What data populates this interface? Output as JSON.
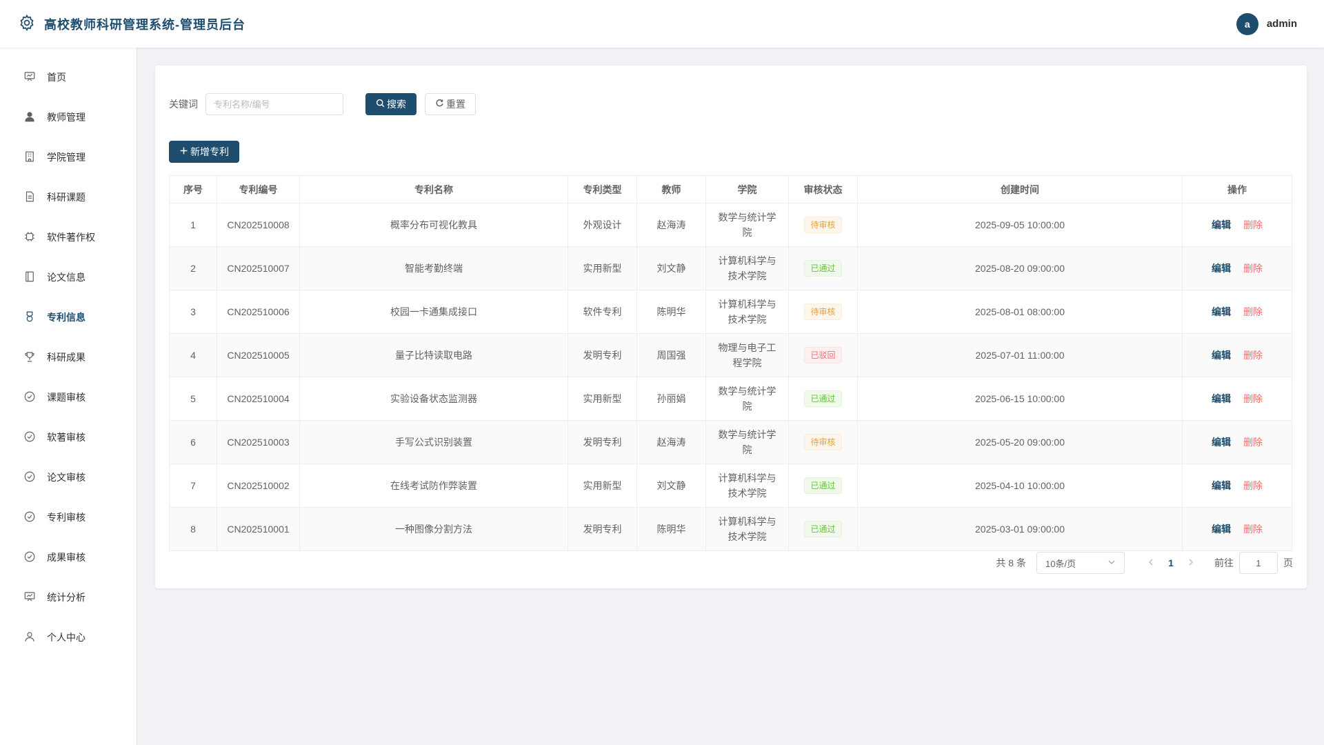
{
  "header": {
    "title": "高校教师科研管理系统-管理员后台",
    "avatar_letter": "a",
    "username": "admin",
    "brand_color": "#1e4d6e"
  },
  "sidebar": {
    "items": [
      {
        "label": "首页",
        "icon": "dashboard-icon"
      },
      {
        "label": "教师管理",
        "icon": "user-solid-icon"
      },
      {
        "label": "学院管理",
        "icon": "building-icon"
      },
      {
        "label": "科研课题",
        "icon": "document-icon"
      },
      {
        "label": "软件著作权",
        "icon": "cpu-icon"
      },
      {
        "label": "论文信息",
        "icon": "notebook-icon"
      },
      {
        "label": "专利信息",
        "icon": "medal-icon",
        "active": true
      },
      {
        "label": "科研成果",
        "icon": "trophy-icon"
      },
      {
        "label": "课题审核",
        "icon": "circle-check-icon"
      },
      {
        "label": "软著审核",
        "icon": "circle-check-icon"
      },
      {
        "label": "论文审核",
        "icon": "circle-check-icon"
      },
      {
        "label": "专利审核",
        "icon": "circle-check-icon"
      },
      {
        "label": "成果审核",
        "icon": "circle-check-icon"
      },
      {
        "label": "统计分析",
        "icon": "presentation-icon"
      },
      {
        "label": "个人中心",
        "icon": "user-icon"
      }
    ]
  },
  "search": {
    "label": "关键词",
    "placeholder": "专利名称/编号",
    "value": "",
    "search_label": "搜索",
    "reset_label": "重置"
  },
  "toolbar": {
    "add_label": "新增专利"
  },
  "table": {
    "columns": [
      "序号",
      "专利编号",
      "专利名称",
      "专利类型",
      "教师",
      "学院",
      "审核状态",
      "创建时间",
      "操作"
    ],
    "edit_label": "编辑",
    "delete_label": "删除",
    "rows": [
      {
        "index": "1",
        "code": "CN202510008",
        "name": "概率分布可视化教具",
        "type": "外观设计",
        "teacher": "赵海涛",
        "college": "数学与统计学院",
        "status": "待审核",
        "status_kind": "pending",
        "created": "2025-09-05 10:00:00"
      },
      {
        "index": "2",
        "code": "CN202510007",
        "name": "智能考勤终端",
        "type": "实用新型",
        "teacher": "刘文静",
        "college": "计算机科学与技术学院",
        "status": "已通过",
        "status_kind": "pass",
        "created": "2025-08-20 09:00:00"
      },
      {
        "index": "3",
        "code": "CN202510006",
        "name": "校园一卡通集成接口",
        "type": "软件专利",
        "teacher": "陈明华",
        "college": "计算机科学与技术学院",
        "status": "待审核",
        "status_kind": "pending",
        "created": "2025-08-01 08:00:00"
      },
      {
        "index": "4",
        "code": "CN202510005",
        "name": "量子比特读取电路",
        "type": "发明专利",
        "teacher": "周国强",
        "college": "物理与电子工程学院",
        "status": "已驳回",
        "status_kind": "reject",
        "created": "2025-07-01 11:00:00"
      },
      {
        "index": "5",
        "code": "CN202510004",
        "name": "实验设备状态监测器",
        "type": "实用新型",
        "teacher": "孙丽娟",
        "college": "数学与统计学院",
        "status": "已通过",
        "status_kind": "pass",
        "created": "2025-06-15 10:00:00"
      },
      {
        "index": "6",
        "code": "CN202510003",
        "name": "手写公式识别装置",
        "type": "发明专利",
        "teacher": "赵海涛",
        "college": "数学与统计学院",
        "status": "待审核",
        "status_kind": "pending",
        "created": "2025-05-20 09:00:00"
      },
      {
        "index": "7",
        "code": "CN202510002",
        "name": "在线考试防作弊装置",
        "type": "实用新型",
        "teacher": "刘文静",
        "college": "计算机科学与技术学院",
        "status": "已通过",
        "status_kind": "pass",
        "created": "2025-04-10 10:00:00"
      },
      {
        "index": "8",
        "code": "CN202510001",
        "name": "一种图像分割方法",
        "type": "发明专利",
        "teacher": "陈明华",
        "college": "计算机科学与技术学院",
        "status": "已通过",
        "status_kind": "pass",
        "created": "2025-03-01 09:00:00"
      }
    ]
  },
  "pagination": {
    "total_text": "共 8 条",
    "page_size": "10条/页",
    "current_page": "1",
    "goto_label": "前往",
    "goto_value": "1",
    "page_unit": "页"
  }
}
